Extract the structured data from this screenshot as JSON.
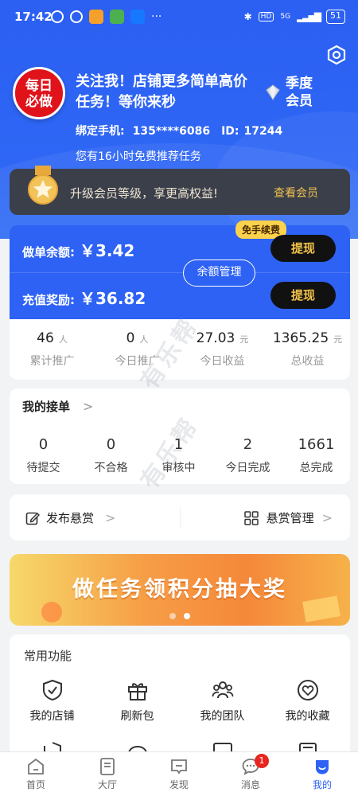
{
  "status_bar": {
    "time": "17:42",
    "network": "5G",
    "hd": "HD",
    "battery": "51"
  },
  "profile": {
    "logo_text": "每日必做",
    "headline": "关注我！店铺更多简单高价任务！等你来秒",
    "vip_label": "季度会员",
    "phone_label": "绑定手机:",
    "phone": "135****6086",
    "id_label": "ID:",
    "id": "17244",
    "free_hint": "您有16小时免费推荐任务"
  },
  "member_bar": {
    "text": "升级会员等级，享更高权益!",
    "link": "查看会员"
  },
  "balance": {
    "order_label": "做单余额:",
    "order_value": "￥3.42",
    "reward_label": "充值奖励:",
    "reward_value": "￥36.82",
    "withdraw": "提现",
    "free_fee_badge": "免手续费",
    "manage": "余额管理"
  },
  "stats": [
    {
      "value": "46",
      "unit": "人",
      "label": "累计推广"
    },
    {
      "value": "0",
      "unit": "人",
      "label": "今日推广"
    },
    {
      "value": "27.03",
      "unit": "元",
      "label": "今日收益"
    },
    {
      "value": "1365.25",
      "unit": "元",
      "label": "总收益"
    }
  ],
  "orders": {
    "title": "我的接单",
    "arrow": ">",
    "items": [
      {
        "value": "0",
        "label": "待提交"
      },
      {
        "value": "0",
        "label": "不合格"
      },
      {
        "value": "1",
        "label": "审核中"
      },
      {
        "value": "2",
        "label": "今日完成"
      },
      {
        "value": "1661",
        "label": "总完成"
      }
    ]
  },
  "reward": {
    "publish": "发布悬赏",
    "manage": "悬赏管理",
    "chevron": ">"
  },
  "banner": {
    "text": "做任务领积分抽大奖"
  },
  "common": {
    "title": "常用功能",
    "items": [
      {
        "label": "我的店铺",
        "icon": "shop-shield-icon"
      },
      {
        "label": "刷新包",
        "icon": "gift-icon"
      },
      {
        "label": "我的团队",
        "icon": "team-icon"
      },
      {
        "label": "我的收藏",
        "icon": "heart-icon"
      }
    ]
  },
  "watermark": "有乐帮",
  "tabbar": [
    {
      "label": "首页",
      "icon": "home-icon"
    },
    {
      "label": "大厅",
      "icon": "hall-icon"
    },
    {
      "label": "发现",
      "icon": "discover-icon"
    },
    {
      "label": "消息",
      "icon": "message-icon",
      "badge": "1"
    },
    {
      "label": "我的",
      "icon": "profile-icon",
      "active": true
    }
  ],
  "colors": {
    "primary": "#2d62f4",
    "gold": "#f4c44b",
    "logo_red": "#e0131b",
    "badge_red": "#e8251e"
  }
}
